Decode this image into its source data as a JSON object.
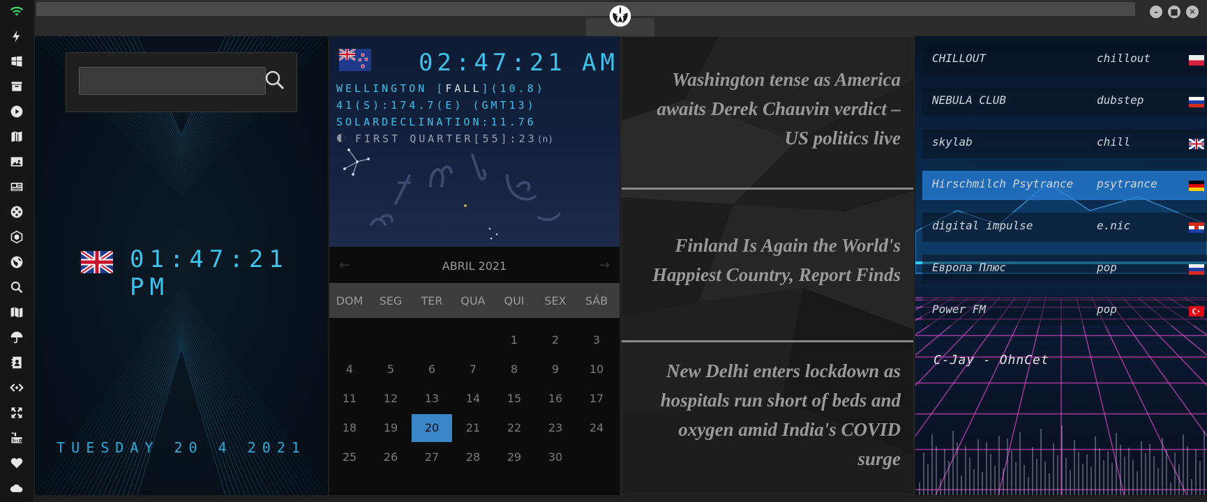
{
  "rail": {
    "icons": [
      "wifi-icon",
      "lightning-icon",
      "windows-icon",
      "archive-icon",
      "play-icon",
      "book-icon",
      "image-icon",
      "newspaper-icon",
      "film-reel-icon",
      "hexagon-icon",
      "globe-icon",
      "search-icon",
      "map-icon",
      "umbrella-icon",
      "contacts-icon",
      "code-icon",
      "fullscreen-icon",
      "youtube-icon",
      "heart-icon",
      "cloud-icon"
    ]
  },
  "window": {
    "buttons": [
      "minimize",
      "maximize",
      "close"
    ]
  },
  "clock_uk": {
    "time": "01:47:21  PM",
    "date": "TUESDAY 20 4 2021"
  },
  "search": {
    "value": "",
    "placeholder": ""
  },
  "astro": {
    "time": "02:47:21",
    "ampm": "AM",
    "line1_prefix": "WELLINGTON [",
    "season": "FALL",
    "line1_suffix": "](10.8)",
    "line2": "41(S):174.7(E) (GMT13)",
    "line3": "SOLARDECLINATION:11.76",
    "moon": "FIRST QUARTER[55]:23",
    "moon_flag": "(n)"
  },
  "calendar": {
    "month": "ABRIL 2021",
    "prev": "←",
    "next": "→",
    "weekdays": [
      "DOM",
      "SEG",
      "TER",
      "QUA",
      "QUI",
      "SEX",
      "SÁB"
    ],
    "days": [
      "1",
      "2",
      "3",
      "4",
      "5",
      "6",
      "7",
      "8",
      "9",
      "10",
      "11",
      "12",
      "13",
      "14",
      "15",
      "16",
      "17",
      "18",
      "19",
      "20",
      "21",
      "22",
      "23",
      "24",
      "25",
      "26",
      "27",
      "28",
      "29",
      "30"
    ],
    "today": "20"
  },
  "news": [
    "Washington tense as America awaits Derek Chauvin verdict – US politics live",
    "Finland Is Again the World's Happiest Country, Report Finds",
    "New Delhi enters lockdown as hospitals run short of beds and oxygen amid India's COVID surge"
  ],
  "radio": {
    "stations": [
      {
        "name": "CHILLOUT",
        "genre": "chillout",
        "flag": "poland"
      },
      {
        "name": "NEBULA CLUB",
        "genre": "dubstep",
        "flag": "russia"
      },
      {
        "name": "skylab",
        "genre": "chill",
        "flag": "uk"
      },
      {
        "name": "Hirschmilch Psytrance",
        "genre": "psytrance",
        "flag": "germany"
      },
      {
        "name": "digital impulse",
        "genre": "e.nic",
        "flag": "croatia"
      },
      {
        "name": "Европа Плюс",
        "genre": "pop",
        "flag": "russia"
      },
      {
        "name": "Power FM",
        "genre": "pop",
        "flag": "turkey"
      }
    ],
    "selected": "Hirschmilch Psytrance",
    "now_playing": "C-Jay - OhnCet"
  },
  "colors": {
    "lcd": "#3ec1ea",
    "selected": "#2882dc",
    "today": "#3a86c8"
  }
}
